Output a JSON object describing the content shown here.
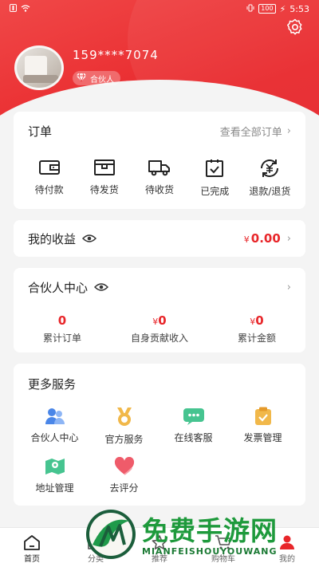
{
  "status_bar": {
    "time": "5:53",
    "battery": "100"
  },
  "colors": {
    "brand_red": "#e8262a",
    "text_gray": "#8a8a8a",
    "watermark_green": "#1e9a3c"
  },
  "profile": {
    "phone": "159****7074",
    "badge": "合伙人"
  },
  "orders": {
    "title": "订单",
    "view_all": "查看全部订单",
    "items": [
      {
        "label": "待付款",
        "icon": "wallet-icon"
      },
      {
        "label": "待发货",
        "icon": "package-icon"
      },
      {
        "label": "待收货",
        "icon": "truck-icon"
      },
      {
        "label": "已完成",
        "icon": "clipboard-check-icon"
      },
      {
        "label": "退款/退货",
        "icon": "refund-icon"
      }
    ]
  },
  "income": {
    "title": "我的收益",
    "currency": "¥",
    "amount": "0.00"
  },
  "partner": {
    "title": "合伙人中心",
    "stats": [
      {
        "value": "0",
        "currency": "",
        "label": "累计订单"
      },
      {
        "value": "0",
        "currency": "¥",
        "label": "自身贡献收入"
      },
      {
        "value": "0",
        "currency": "¥",
        "label": "累计金额"
      }
    ]
  },
  "services": {
    "title": "更多服务",
    "items": [
      {
        "label": "合伙人中心",
        "icon": "partner-icon"
      },
      {
        "label": "官方服务",
        "icon": "medal-icon"
      },
      {
        "label": "在线客服",
        "icon": "chat-icon"
      },
      {
        "label": "发票管理",
        "icon": "invoice-icon"
      },
      {
        "label": "地址管理",
        "icon": "map-icon"
      },
      {
        "label": "去评分",
        "icon": "heart-icon"
      }
    ]
  },
  "tabbar": [
    {
      "label": "首页",
      "icon": "home-icon"
    },
    {
      "label": "分类",
      "icon": "category-icon"
    },
    {
      "label": "推荐",
      "icon": "recommend-icon"
    },
    {
      "label": "购物车",
      "icon": "cart-icon"
    },
    {
      "label": "我的",
      "icon": "user-icon"
    }
  ],
  "watermark": {
    "title": "免费手游网",
    "subtitle": "MIANFEISHOUYOUWANG"
  }
}
